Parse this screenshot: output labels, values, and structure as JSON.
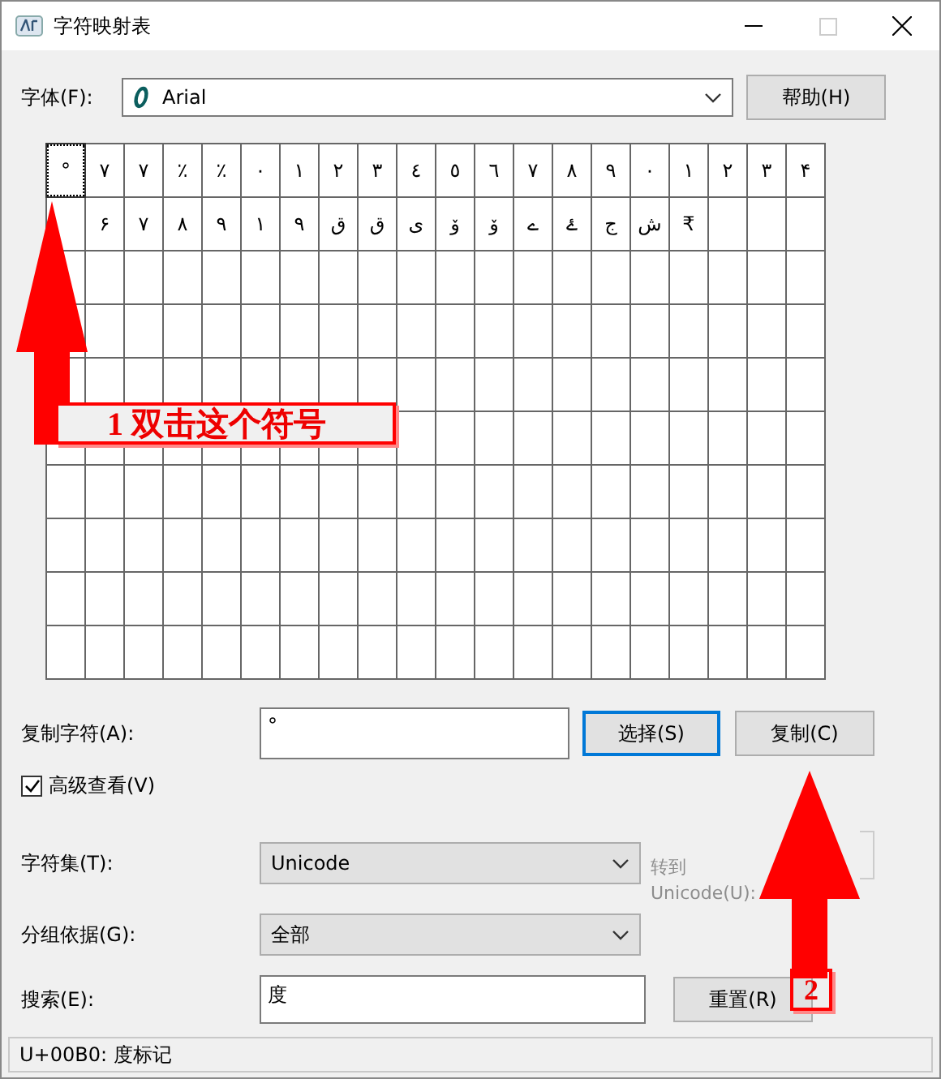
{
  "window": {
    "title": "字符映射表",
    "maximize_disabled": true
  },
  "font": {
    "label": "字体(F):",
    "value": "Arial"
  },
  "help_button": "帮助(H)",
  "grid": {
    "rows": [
      [
        {
          "char": "°",
          "selected": true
        },
        {
          "char": "٧",
          "selected": false
        },
        {
          "char": "٧",
          "selected": false
        },
        {
          "char": "٪",
          "selected": false
        },
        {
          "char": "٪",
          "selected": false
        },
        {
          "char": "٠",
          "selected": false
        },
        {
          "char": "١",
          "selected": false
        },
        {
          "char": "٢",
          "selected": false
        },
        {
          "char": "٣",
          "selected": false
        },
        {
          "char": "٤",
          "selected": false
        },
        {
          "char": "٥",
          "selected": false
        },
        {
          "char": "٦",
          "selected": false
        },
        {
          "char": "٧",
          "selected": false
        },
        {
          "char": "٨",
          "selected": false
        },
        {
          "char": "٩",
          "selected": false
        },
        {
          "char": "٠",
          "selected": false
        },
        {
          "char": "١",
          "selected": false
        },
        {
          "char": "٢",
          "selected": false
        },
        {
          "char": "٣",
          "selected": false
        },
        {
          "char": "۴",
          "selected": false
        }
      ],
      [
        null,
        {
          "char": "۶",
          "selected": false
        },
        {
          "char": "۷",
          "selected": false
        },
        {
          "char": "۸",
          "selected": false
        },
        {
          "char": "۹",
          "selected": false
        },
        {
          "char": "١",
          "selected": false
        },
        {
          "char": "٩",
          "selected": false
        },
        {
          "char": "ق",
          "selected": false
        },
        {
          "char": "ق",
          "selected": false
        },
        {
          "char": "ی",
          "selected": false
        },
        {
          "char": "ۆ",
          "selected": false
        },
        {
          "char": "ۆ",
          "selected": false
        },
        {
          "char": "ے",
          "selected": false
        },
        {
          "char": "ۓ",
          "selected": false
        },
        {
          "char": "ج",
          "selected": false
        },
        {
          "char": "ش",
          "selected": false
        },
        {
          "char": "₹",
          "selected": false
        }
      ]
    ]
  },
  "copy": {
    "label": "复制字符(A):",
    "value": "°",
    "select_button": "选择(S)",
    "copy_button": "复制(C)"
  },
  "advanced": {
    "label": "高级查看(V)",
    "checked": true
  },
  "charset": {
    "label": "字符集(T):",
    "value": "Unicode"
  },
  "goto_unicode": {
    "label": "转到 Unicode(U):",
    "disabled": true
  },
  "group_by": {
    "label": "分组依据(G):",
    "value": "全部"
  },
  "search": {
    "label": "搜索(E):",
    "value": "度",
    "reset_button": "重置(R)"
  },
  "status_bar": "U+00B0: 度标记",
  "annotations": [
    {
      "kind": "arrow"
    },
    {
      "kind": "label",
      "text": "1 双击这个符号"
    },
    {
      "kind": "arrow"
    },
    {
      "kind": "label",
      "text": "2"
    }
  ]
}
